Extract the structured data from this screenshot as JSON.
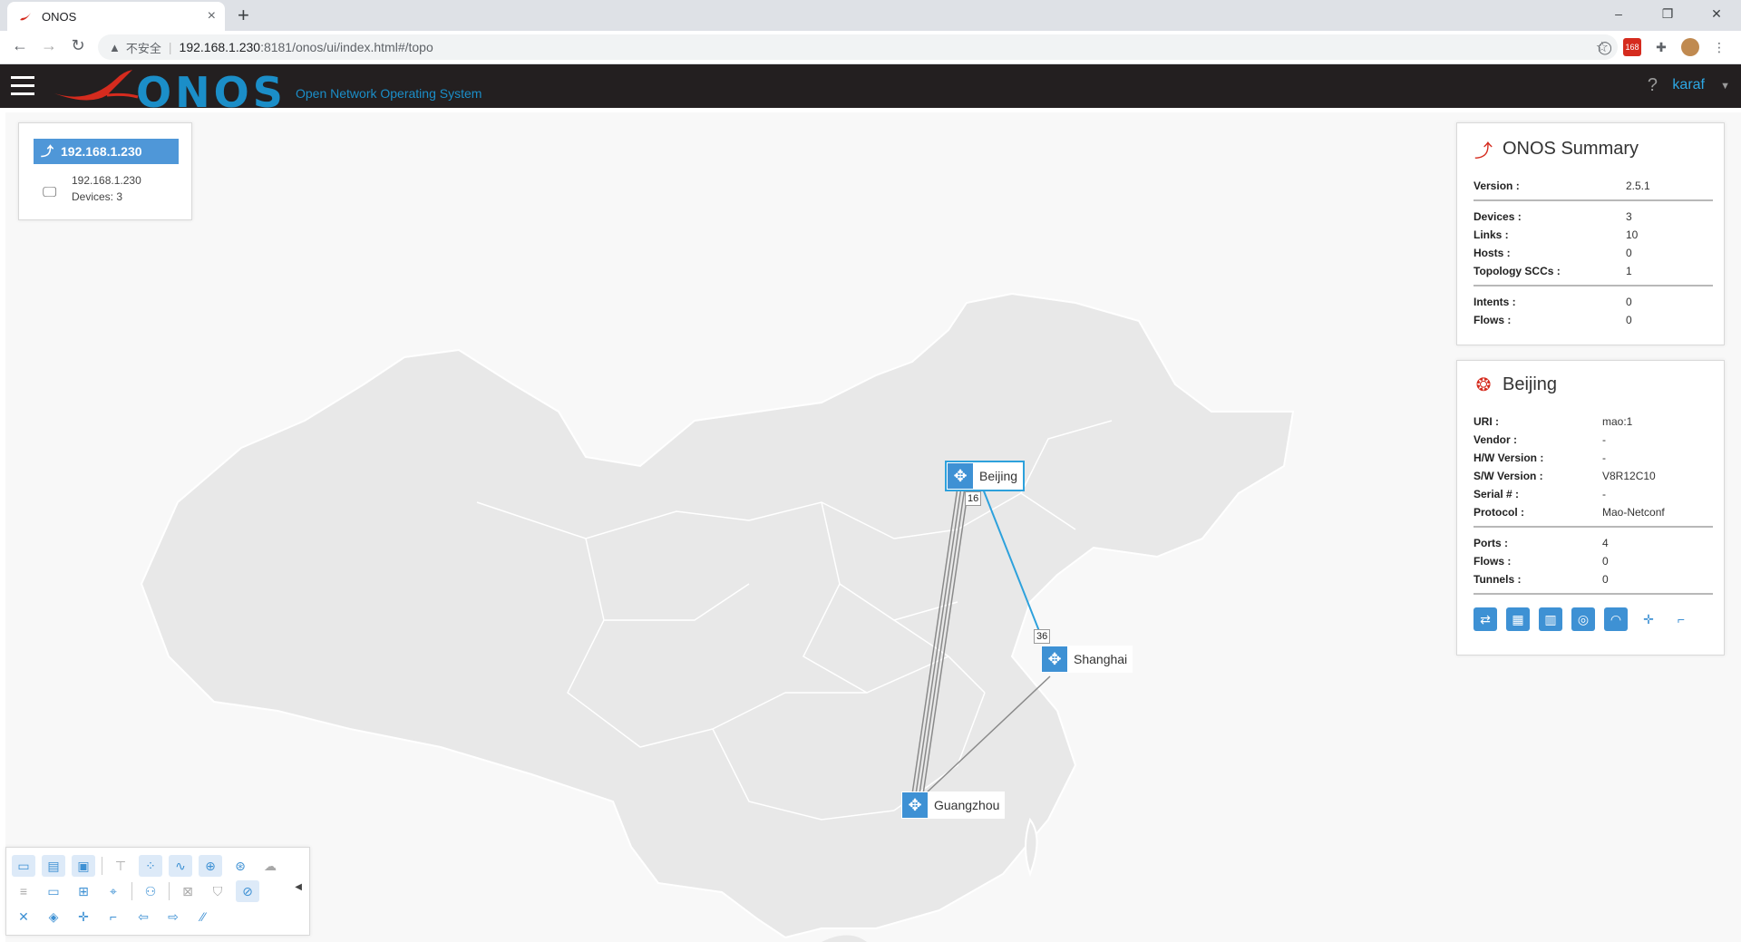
{
  "browser": {
    "tab_title": "ONOS",
    "tab_close": "×",
    "new_tab": "+",
    "insecure_label": "不安全",
    "url_host": "192.168.1.230",
    "url_path": ":8181/onos/ui/index.html#/topo",
    "extension_badge": "168",
    "win_minimize": "–",
    "win_restore": "❐",
    "win_close": "✕"
  },
  "onos": {
    "logo": "ONOS",
    "tagline": "Open Network Operating System",
    "help": "?",
    "user": "karaf"
  },
  "instance_panel": {
    "title": "192.168.1.230",
    "ip": "192.168.1.230",
    "devices": "Devices: 3"
  },
  "summary": {
    "title": "ONOS Summary",
    "rows": [
      {
        "label": "Version :",
        "value": "2.5.1"
      },
      {
        "label": "Devices :",
        "value": "3"
      },
      {
        "label": "Links :",
        "value": "10"
      },
      {
        "label": "Hosts :",
        "value": "0"
      },
      {
        "label": "Topology SCCs :",
        "value": "1"
      },
      {
        "label": "Intents :",
        "value": "0"
      },
      {
        "label": "Flows :",
        "value": "0"
      }
    ]
  },
  "device_detail": {
    "title": "Beijing",
    "rows": [
      {
        "label": "URI :",
        "value": "mao:1"
      },
      {
        "label": "Vendor :",
        "value": "-"
      },
      {
        "label": "H/W Version :",
        "value": "-"
      },
      {
        "label": "S/W Version :",
        "value": "V8R12C10"
      },
      {
        "label": "Serial # :",
        "value": "-"
      },
      {
        "label": "Protocol :",
        "value": "Mao-Netconf"
      },
      {
        "label": "Ports :",
        "value": "4"
      },
      {
        "label": "Flows :",
        "value": "0"
      },
      {
        "label": "Tunnels :",
        "value": "0"
      }
    ]
  },
  "topology": {
    "nodes": [
      {
        "name": "Beijing"
      },
      {
        "name": "Shanghai"
      },
      {
        "name": "Guangzhou"
      }
    ],
    "ports": {
      "beijing_port": "16",
      "shanghai_port": "36"
    }
  },
  "colors": {
    "accent": "#3e91d4",
    "header_bg": "#231f20",
    "selected_link": "#2da1dc",
    "map_fill": "#e8e8e8"
  }
}
